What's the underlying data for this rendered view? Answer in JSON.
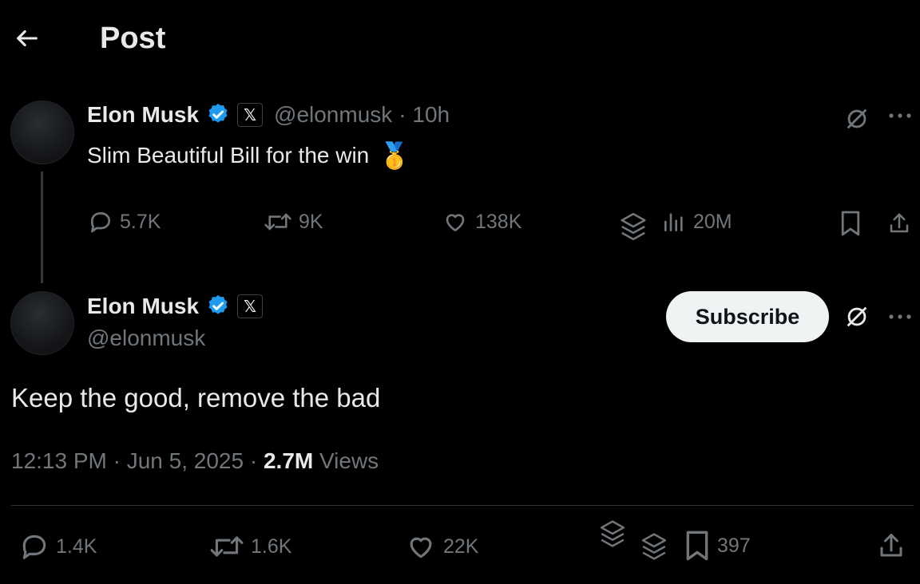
{
  "header": {
    "title": "Post",
    "back_icon": "arrow-left-icon"
  },
  "parent_post": {
    "author_name": "Elon Musk",
    "handle": "@elonmusk",
    "time": "· 10h",
    "text": "Slim Beautiful Bill for the win",
    "emoji": "🥇",
    "stats": {
      "replies": "5.7K",
      "reposts": "9K",
      "likes": "138K",
      "views": "20M"
    }
  },
  "main_post": {
    "author_name": "Elon Musk",
    "handle": "@elonmusk",
    "subscribe_label": "Subscribe",
    "text": "Keep the good, remove the bad",
    "timestamp": "12:13 PM · Jun 5, 2025 · ",
    "views_count": "2.7M",
    "views_label": " Views",
    "stats": {
      "replies": "1.4K",
      "reposts": "1.6K",
      "likes": "22K",
      "bookmarks": "397"
    }
  },
  "badges": {
    "x_glyph": "𝕏"
  },
  "colors": {
    "background": "#000000",
    "text": "#e7e9ea",
    "muted": "#71767b",
    "verified": "#1d9bf0",
    "subscribe_bg": "#eff3f4"
  }
}
